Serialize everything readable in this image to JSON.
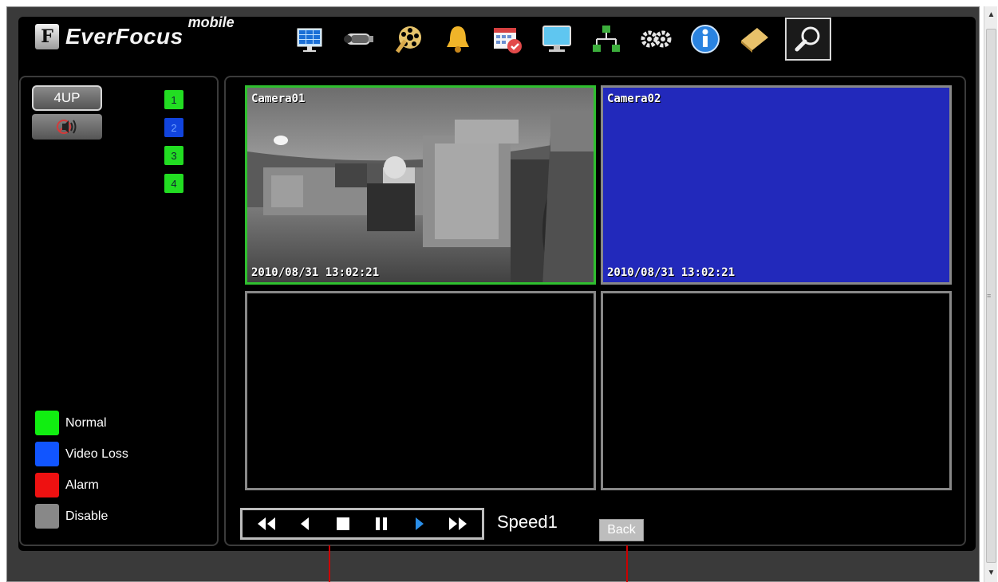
{
  "header": {
    "logo_mark": "F",
    "brand": "EverFocus",
    "brand_sub": "mobile",
    "toolbar": [
      {
        "name": "live-view-icon"
      },
      {
        "name": "camera-icon"
      },
      {
        "name": "playback-reel-icon"
      },
      {
        "name": "alarm-bell-icon"
      },
      {
        "name": "schedule-calendar-icon"
      },
      {
        "name": "display-monitor-icon"
      },
      {
        "name": "network-icon"
      },
      {
        "name": "settings-gears-icon"
      },
      {
        "name": "info-icon"
      },
      {
        "name": "notes-icon"
      },
      {
        "name": "search-icon",
        "active": true
      }
    ]
  },
  "left_panel": {
    "layout_button": "4UP",
    "audio_button": "mute-audio-icon",
    "channels": [
      {
        "label": "1",
        "color": "#22dd22"
      },
      {
        "label": "2",
        "color": "#1144dd"
      },
      {
        "label": "3",
        "color": "#22dd22"
      },
      {
        "label": "4",
        "color": "#22dd22"
      }
    ],
    "legend": [
      {
        "label": "Normal",
        "color": "#11ee11"
      },
      {
        "label": "Video Loss",
        "color": "#1155ff"
      },
      {
        "label": "Alarm",
        "color": "#ee1111"
      },
      {
        "label": "Disable",
        "color": "#888888"
      }
    ]
  },
  "cameras": [
    {
      "title": "Camera01",
      "timestamp": "2010/08/31  13:02:21",
      "state": "video"
    },
    {
      "title": "Camera02",
      "timestamp": "2010/08/31  13:02:21",
      "state": "video-loss"
    },
    {
      "title": "",
      "timestamp": "",
      "state": "empty"
    },
    {
      "title": "",
      "timestamp": "",
      "state": "empty"
    }
  ],
  "playback": {
    "speed_label": "Speed1",
    "back_label": "Back",
    "buttons": [
      "fast-rewind-icon",
      "step-back-icon",
      "stop-icon",
      "pause-icon",
      "play-icon",
      "fast-forward-icon"
    ]
  },
  "colors": {
    "selected_border": "#2fbf2f",
    "video_loss_bg": "#2229bb"
  }
}
